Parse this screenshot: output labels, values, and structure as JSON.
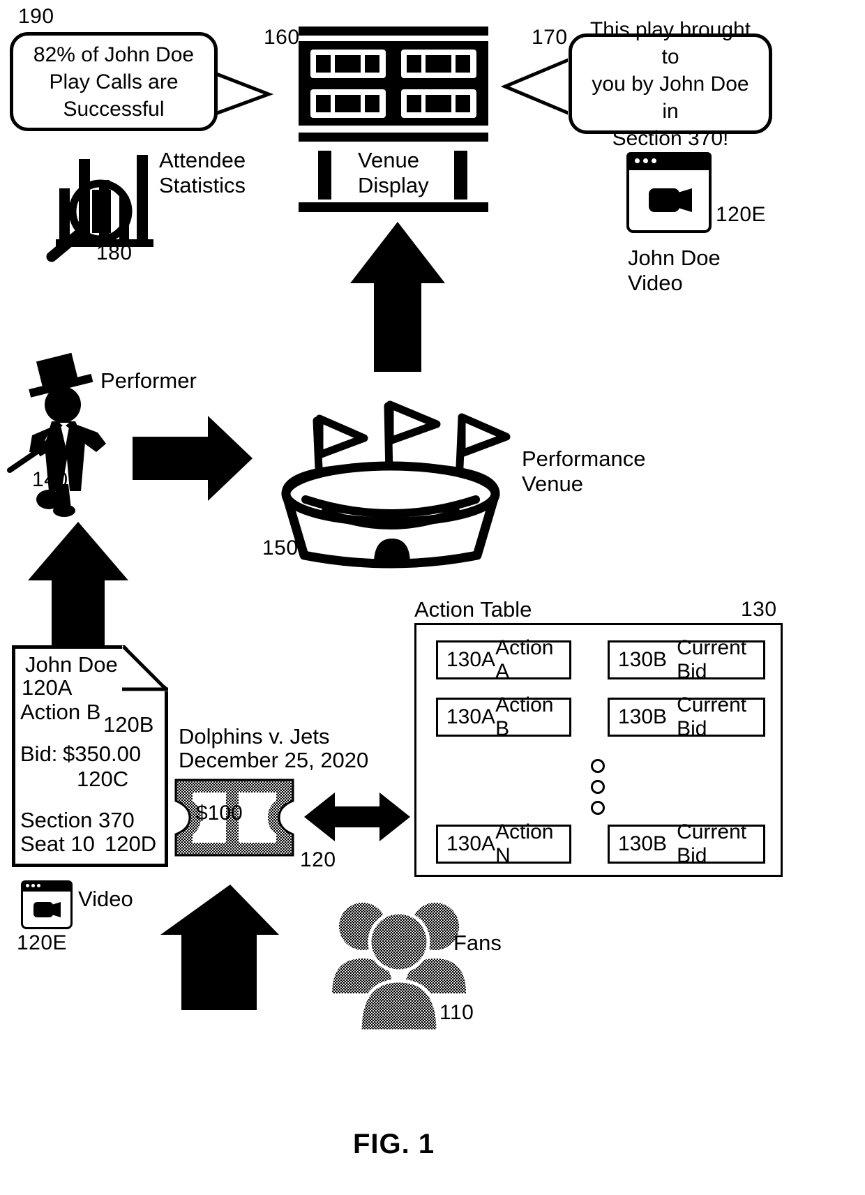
{
  "figure": {
    "caption": "FIG. 1"
  },
  "stats_bubble": {
    "ref": "190",
    "line1": "82% of John Doe",
    "line2": "Play Calls are",
    "line3": "Successful"
  },
  "sponsor_bubble": {
    "ref": "170",
    "line1": "This play brought to",
    "line2": "you by John Doe in",
    "line3": "Section 370!"
  },
  "attendee_stats": {
    "ref": "180",
    "label_line1": "Attendee",
    "label_line2": "Statistics",
    "icon": "magnifier-barchart-icon"
  },
  "venue_display": {
    "ref": "160",
    "label_line1": "Venue",
    "label_line2": "Display",
    "icon": "scoreboard-icon"
  },
  "john_doe_video": {
    "ref": "120E",
    "label_line1": "John Doe",
    "label_line2": "Video",
    "icon": "browser-video-icon"
  },
  "performer": {
    "ref": "140",
    "label": "Performer",
    "icon": "tophat-dancer-icon"
  },
  "performance_venue": {
    "ref": "150",
    "label_line1": "Performance",
    "label_line2": "Venue",
    "icon": "stadium-flags-icon"
  },
  "document": {
    "name": "John Doe",
    "name_ref": "120A",
    "action": "Action B",
    "action_ref": "120B",
    "bid_label": "Bid:",
    "bid_value": "$350.00",
    "bid_ref": "120C",
    "section": "Section 370",
    "seat": "Seat 10",
    "seat_ref": "120D"
  },
  "doc_video": {
    "ref": "120E",
    "label": "Video",
    "icon": "browser-video-icon"
  },
  "ticket": {
    "ref": "120",
    "event": "Dolphins v. Jets",
    "date": "December 25, 2020",
    "price": "$100",
    "icon": "ticket-icon"
  },
  "fans": {
    "ref": "110",
    "label": "Fans",
    "icon": "people-group-icon"
  },
  "action_table": {
    "ref": "130",
    "title": "Action Table",
    "ellipsis": "○ ○ ○",
    "rows": [
      {
        "action_ref": "130A",
        "action": "Action A",
        "bid_ref": "130B",
        "bid": "Current Bid"
      },
      {
        "action_ref": "130A",
        "action": "Action B",
        "bid_ref": "130B",
        "bid": "Current Bid"
      },
      {
        "action_ref": "130A",
        "action": "Action N",
        "bid_ref": "130B",
        "bid": "Current Bid"
      }
    ]
  },
  "colors": {
    "ink": "#000000",
    "paper": "#ffffff",
    "halftone": "#3a3a3a"
  }
}
